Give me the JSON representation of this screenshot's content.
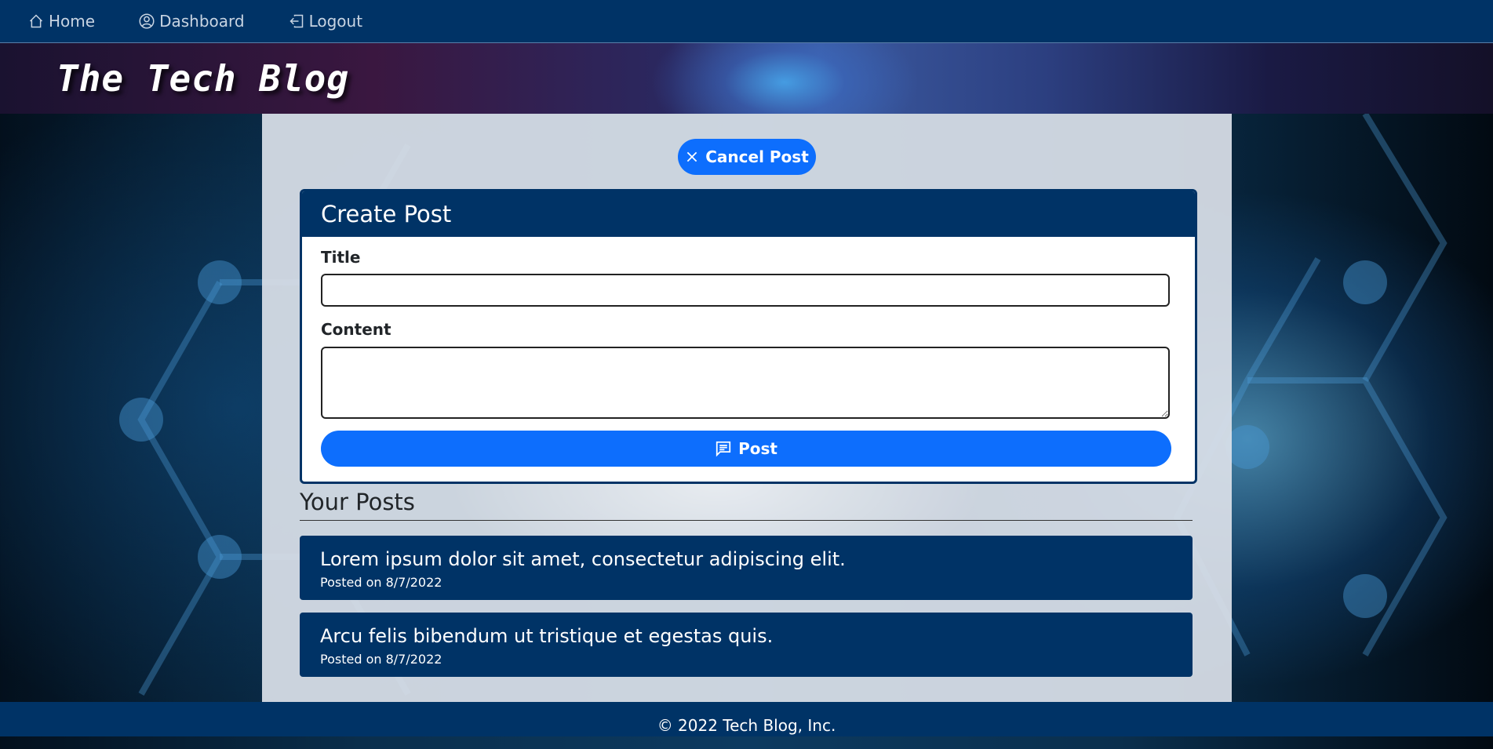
{
  "nav": {
    "home": {
      "label": "Home",
      "icon": "house-icon"
    },
    "dashboard": {
      "label": "Dashboard",
      "icon": "person-circle-icon"
    },
    "logout": {
      "label": "Logout",
      "icon": "box-arrow-left-icon"
    }
  },
  "header": {
    "brand": "The Tech Blog"
  },
  "main": {
    "cancel_button": {
      "label": "Cancel Post",
      "icon": "x-icon"
    },
    "form": {
      "heading": "Create Post",
      "title_label": "Title",
      "title_value": "",
      "content_label": "Content",
      "content_value": "",
      "post_button": {
        "label": "Post",
        "icon": "chat-left-text-icon"
      }
    },
    "posts_heading": "Your Posts",
    "posts": [
      {
        "title": "Lorem ipsum dolor sit amet, consectetur adipiscing elit.",
        "date": "Posted on 8/7/2022"
      },
      {
        "title": "Arcu felis bibendum ut tristique et egestas quis.",
        "date": "Posted on 8/7/2022"
      }
    ]
  },
  "footer": {
    "text": "© 2022 Tech Blog, Inc."
  },
  "colors": {
    "navy": "#003366",
    "accent": "#0d6efd",
    "panel": "#dae0e8"
  }
}
